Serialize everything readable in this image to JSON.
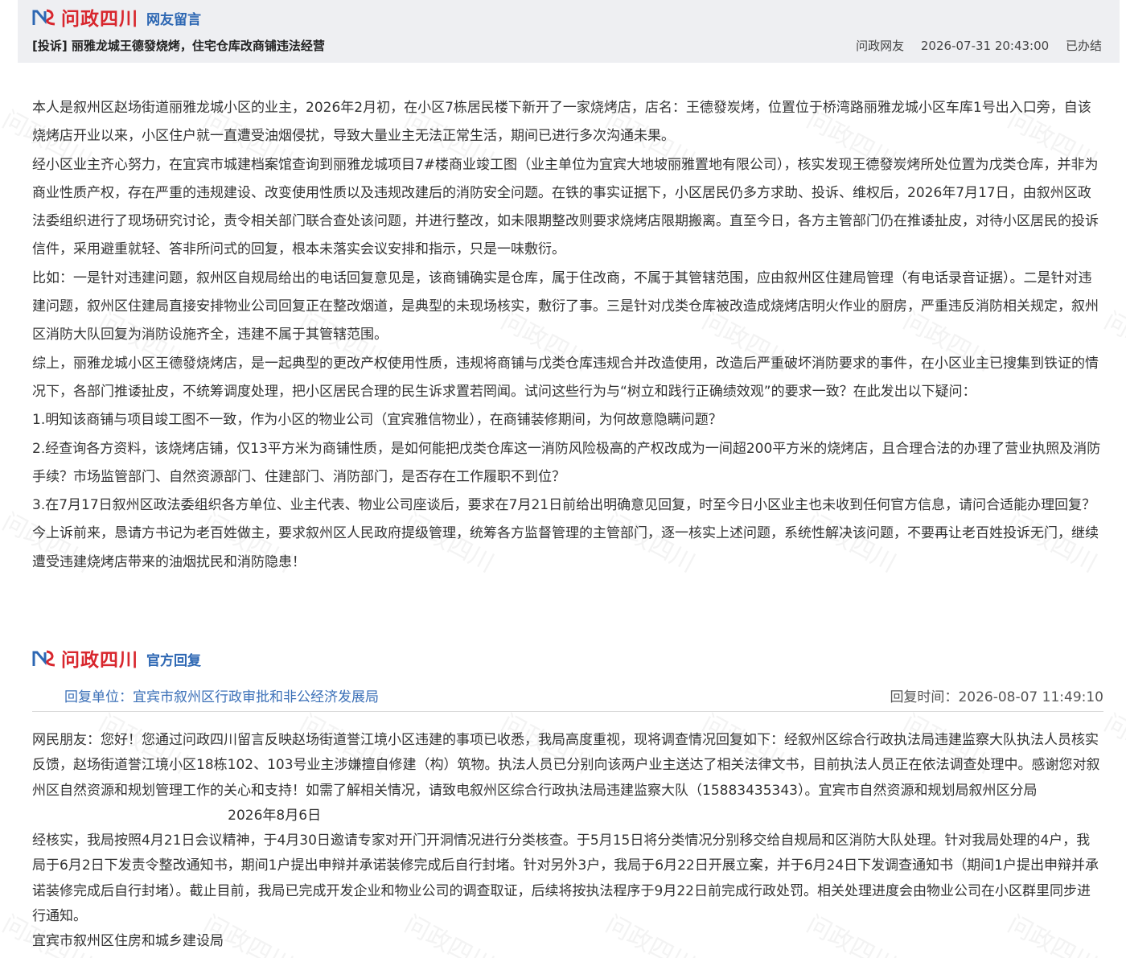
{
  "colors": {
    "brand_red": "#d8262d",
    "brand_blue": "#2d67b3",
    "link_blue": "#3a6fb7",
    "band_bg": "#eeeff2"
  },
  "icons": {
    "logo": "wenzheng-sichuan-logo-icon"
  },
  "brand": {
    "name": "问政四川",
    "top_sub": "网友留言",
    "reply_sub": "官方回复"
  },
  "complaint": {
    "title": "[投诉] 丽雅龙城王德發烧烤，住宅仓库改商铺违法经营",
    "author": "问政网友",
    "time": "2026-07-31 20:43:00",
    "status": "已办结",
    "paragraphs": [
      "本人是叙州区赵场街道丽雅龙城小区的业主，2026年2月初，在小区7栋居民楼下新开了一家烧烤店，店名：王德發炭烤，位置位于桥湾路丽雅龙城小区车库1号出入口旁，自该烧烤店开业以来，小区住户就一直遭受油烟侵扰，导致大量业主无法正常生活，期间已进行多次沟通未果。",
      "经小区业主齐心努力，在宜宾市城建档案馆查询到丽雅龙城项目7#楼商业竣工图（业主单位为宜宾大地坡丽雅置地有限公司），核实发现王德發炭烤所处位置为戊类仓库，并非为商业性质产权，存在严重的违规建设、改变使用性质以及违规改建后的消防安全问题。在铁的事实证据下，小区居民仍多方求助、投诉、维权后，2026年7月17日，由叙州区政法委组织进行了现场研究讨论，责令相关部门联合查处该问题，并进行整改，如未限期整改则要求烧烤店限期搬离。直至今日，各方主管部门仍在推诿扯皮，对待小区居民的投诉信件，采用避重就轻、答非所问式的回复，根本未落实会议安排和指示，只是一味敷衍。",
      "比如：一是针对违建问题，叙州区自规局给出的电话回复意见是，该商铺确实是仓库，属于住改商，不属于其管辖范围，应由叙州区住建局管理（有电话录音证据）。二是针对违建问题，叙州区住建局直接安排物业公司回复正在整改烟道，是典型的未现场核实，敷衍了事。三是针对戊类仓库被改造成烧烤店明火作业的厨房，严重违反消防相关规定，叙州区消防大队回复为消防设施齐全，违建不属于其管辖范围。",
      "综上，丽雅龙城小区王德發烧烤店，是一起典型的更改产权使用性质，违规将商铺与戊类仓库违规合并改造使用，改造后严重破坏消防要求的事件，在小区业主已搜集到铁证的情况下，各部门推诿扯皮，不统筹调度处理，把小区居民合理的民生诉求置若罔闻。试问这些行为与“树立和践行正确绩效观”的要求一致？在此发出以下疑问：",
      "1.明知该商铺与项目竣工图不一致，作为小区的物业公司（宜宾雅信物业），在商铺装修期间，为何故意隐瞒问题？",
      "2.经查询各方资料，该烧烤店铺，仅13平方米为商铺性质，是如何能把戊类仓库这一消防风险极高的产权改成为一间超200平方米的烧烤店，且合理合法的办理了营业执照及消防手续？市场监管部门、自然资源部门、住建部门、消防部门，是否存在工作履职不到位？",
      "3.在7月17日叙州区政法委组织各方单位、业主代表、物业公司座谈后，要求在7月21日前给出明确意见回复，时至今日小区业主也未收到任何官方信息，请问合适能办理回复？",
      "今上诉前来，恳请方书记为老百姓做主，要求叙州区人民政府提级管理，统筹各方监督管理的主管部门，逐一核实上述问题，系统性解决该问题，不要再让老百姓投诉无门，继续遭受违建烧烤店带来的油烟扰民和消防隐患！"
    ]
  },
  "reply": {
    "unit_label": "回复单位：",
    "unit": "宜宾市叙州区行政审批和非公经济发展局",
    "time_label": "回复时间：",
    "time": "2026-08-07 11:49:10",
    "paragraphs": [
      "网民朋友：您好！您通过问政四川留言反映赵场街道誉江境小区违建的事项已收悉，我局高度重视，现将调查情况回复如下：经叙州区综合行政执法局违建监察大队执法人员核实反馈，赵场街道誉江境小区18栋102、103号业主涉嫌擅自修建（构）筑物。执法人员已分别向该两户业主送达了相关法律文书，目前执法人员正在依法调查处理中。感谢您对叙州区自然资源和规划管理工作的关心和支持！如需了解相关情况，请致电叙州区综合行政执法局违建监察大队（15883435343）。宜宾市自然资源和规划局叙州区分局"
    ],
    "date_line": "2026年8月6日",
    "paragraphs2": [
      "经核实，我局按照4月21日会议精神，于4月30日邀请专家对开门开洞情况进行分类核查。于5月15日将分类情况分别移交给自规局和区消防大队处理。针对我局处理的4户，我局于6月2日下发责令整改通知书，期间1户提出申辩并承诺装修完成后自行封堵。针对另外3户，我局于6月22日开展立案，并于6月24日下发调查通知书（期间1户提出申辩并承诺装修完成后自行封堵）。截止目前，我局已完成开发企业和物业公司的调查取证，后续将按执法程序于9月22日前完成行政处罚。相关处理进度会由物业公司在小区群里同步进行通知。",
      "宜宾市叙州区住房和城乡建设局"
    ]
  }
}
